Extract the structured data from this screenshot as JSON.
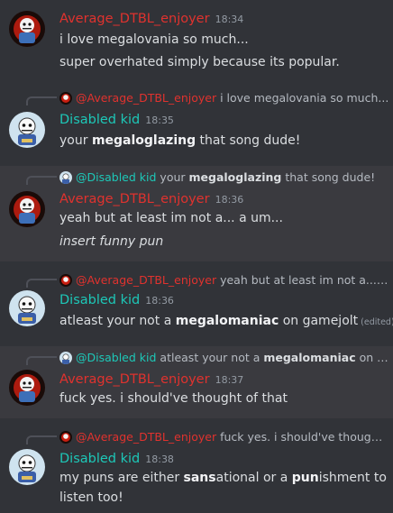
{
  "users": {
    "a": {
      "name": "Average_DTBL_enjoyer",
      "mention": "@Average_DTBL_enjoyer",
      "color": "#e0322e"
    },
    "b": {
      "name": "Disabled kid",
      "mention": "@Disabled kid",
      "color": "#1dc8b8"
    }
  },
  "messages": [
    {
      "author": "Average_DTBL_enjoyer",
      "time": "18:34",
      "lines": [
        "i love megalovania so much...",
        "super overhated simply because its popular."
      ]
    },
    {
      "author": "Disabled kid",
      "time": "18:35",
      "reply": {
        "to": "@Average_DTBL_enjoyer",
        "text": "i love megalovania so much..."
      },
      "text": {
        "pre": "your ",
        "bold": "megaloglazing",
        "post": " that song dude!"
      }
    },
    {
      "author": "Average_DTBL_enjoyer",
      "time": "18:36",
      "reply": {
        "to": "@Disabled kid",
        "pre": "your ",
        "bold": "megaloglazing",
        "post": " that song dude!"
      },
      "lines": [
        "yeah but at least im not a... a um...",
        "insert funny pun"
      ]
    },
    {
      "author": "Disabled kid",
      "time": "18:36",
      "reply": {
        "to": "@Average_DTBL_enjoyer",
        "text": "yeah but at least im not a... a u..."
      },
      "text": {
        "pre": "atleast your not a ",
        "bold": "megalomaniac",
        "post": " on gamejolt"
      },
      "edited": "(edited)"
    },
    {
      "author": "Average_DTBL_enjoyer",
      "time": "18:37",
      "reply": {
        "to": "@Disabled kid",
        "pre": "atleast your not a ",
        "bold": "megalomaniac",
        "post": " on gam..."
      },
      "text": "fuck yes. i should've thought of that"
    },
    {
      "author": "Disabled kid",
      "time": "18:38",
      "reply": {
        "to": "@Average_DTBL_enjoyer",
        "text": "fuck yes. i should've thought o..."
      },
      "text": {
        "pre1": "my puns are either ",
        "bold1": "sans",
        "mid": "ational or a ",
        "bold2": "pun",
        "post1": "ishment to",
        "line2": "listen too!"
      }
    }
  ]
}
